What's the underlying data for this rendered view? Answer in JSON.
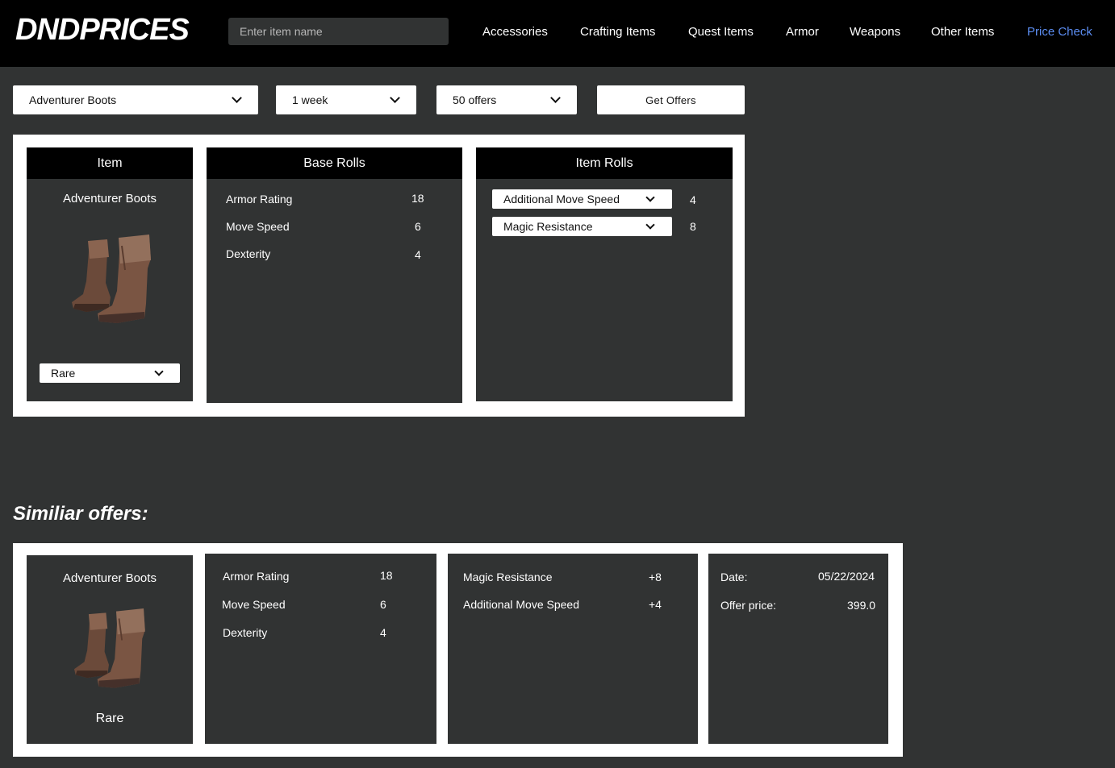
{
  "header": {
    "logo": "DNDPRICES",
    "search_placeholder": "Enter item name",
    "nav": [
      "Accessories",
      "Crafting Items",
      "Quest Items",
      "Armor",
      "Weapons",
      "Other Items",
      "Price Check"
    ],
    "active_nav": "Price Check",
    "accent_color": "#5b8cf0"
  },
  "controls": {
    "item_select": "Adventurer Boots",
    "period_select": "1 week",
    "offers_select": "50 offers",
    "get_offers_label": "Get Offers"
  },
  "item_panel": {
    "title": "Item",
    "name": "Adventurer Boots",
    "image_icon": "boots-icon",
    "rarity": "Rare"
  },
  "base_rolls": {
    "title": "Base Rolls",
    "rows": [
      {
        "label": "Armor Rating",
        "value": "18"
      },
      {
        "label": "Move Speed",
        "value": "6"
      },
      {
        "label": "Dexterity",
        "value": "4"
      }
    ]
  },
  "item_rolls": {
    "title": "Item Rolls",
    "rows": [
      {
        "label": "Additional Move Speed",
        "value": "4"
      },
      {
        "label": "Magic Resistance",
        "value": "8"
      }
    ]
  },
  "similar": {
    "title": "Similiar offers:",
    "offer": {
      "name": "Adventurer Boots",
      "rarity": "Rare",
      "base_rolls": [
        {
          "label": "Armor Rating",
          "value": "18"
        },
        {
          "label": "Move Speed",
          "value": "6"
        },
        {
          "label": "Dexterity",
          "value": "4"
        }
      ],
      "item_rolls": [
        {
          "label": "Magic Resistance",
          "value": "+8"
        },
        {
          "label": "Additional Move Speed",
          "value": "+4"
        }
      ],
      "date_label": "Date:",
      "date": "05/22/2024",
      "price_label": "Offer price:",
      "price": "399.0"
    }
  }
}
